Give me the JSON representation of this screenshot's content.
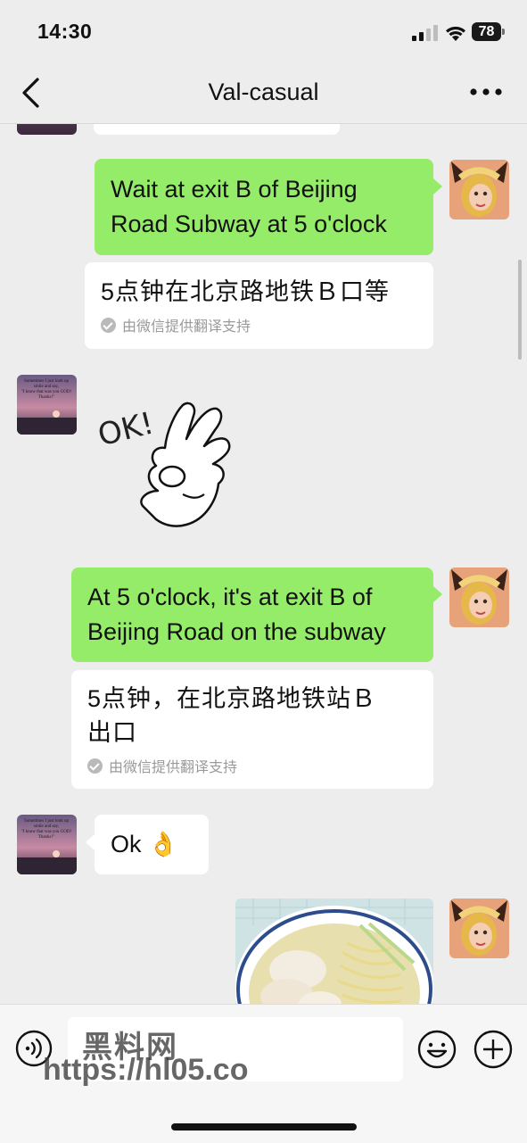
{
  "status_bar": {
    "time": "14:30",
    "battery": "78"
  },
  "nav": {
    "title": "Val-casual"
  },
  "messages": [
    {
      "id": "m1",
      "side": "right",
      "text_line1": "Wait at exit B of Beijing",
      "text_line2": "Road Subway at 5 o'clock",
      "translation": "5点钟在北京路地铁Ｂ口等",
      "translation_note": "由微信提供翻译支持"
    },
    {
      "id": "m2",
      "side": "left",
      "sticker_text": "OK!"
    },
    {
      "id": "m3",
      "side": "right",
      "text_line1": "At 5 o'clock, it's at exit B of",
      "text_line2": "Beijing Road on the subway",
      "translation_line1": "5点钟，在北京路地铁站Ｂ",
      "translation_line2": "出口",
      "translation_note": "由微信提供翻译支持"
    },
    {
      "id": "m4",
      "side": "left",
      "text": "Ok",
      "emoji": "👌"
    },
    {
      "id": "m5",
      "side": "right",
      "image": "wonton-noodle-soup-photo"
    }
  ],
  "avatar_caption": {
    "line1": "Sometimes I just look up",
    "line2": "smile and say,",
    "line3": "\"I know that was you GOD!",
    "line4": "Thanks!\""
  },
  "watermark": {
    "title": "黑料网",
    "url": "https://hl05.co"
  },
  "icons": [
    "back-icon",
    "more-icon",
    "voice-icon",
    "emoji-icon",
    "plus-icon",
    "check-icon"
  ],
  "colors": {
    "bubble_self": "#95ec69",
    "bubble_other": "#ffffff",
    "background": "#ededed"
  }
}
